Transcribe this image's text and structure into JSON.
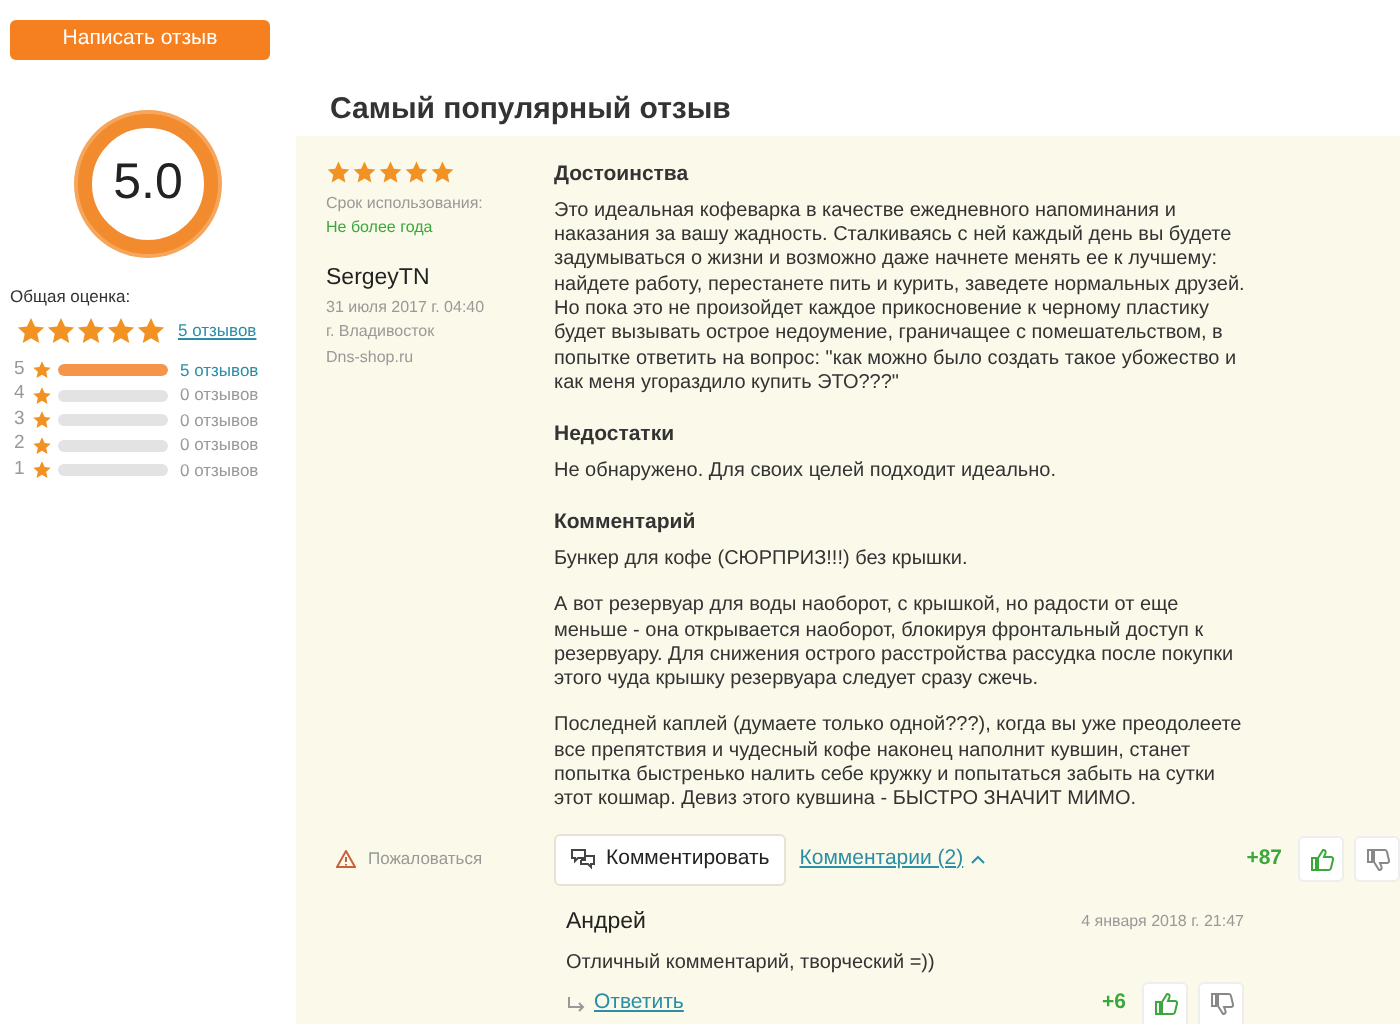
{
  "write_review_button": "Написать отзыв",
  "rating": {
    "score": "5.0",
    "overall_label": "Общая оценка:",
    "stars": 5,
    "count_link": "5 отзывов",
    "distribution": [
      {
        "grade": "5",
        "level": 1,
        "count": "5 отзывов",
        "link": true
      },
      {
        "grade": "4",
        "level": 0,
        "count": "0 отзывов",
        "link": false
      },
      {
        "grade": "3",
        "level": 0,
        "count": "0 отзывов",
        "link": false
      },
      {
        "grade": "2",
        "level": 0,
        "count": "0 отзывов",
        "link": false
      },
      {
        "grade": "1",
        "level": 0,
        "count": "0 отзывов",
        "link": false
      }
    ]
  },
  "section_title": "Самый популярный отзыв",
  "review": {
    "stars": 5,
    "usage_label": "Срок использования:",
    "usage_value": "Не более года",
    "author": "SergeyTN",
    "date": "31 июля 2017 г. 04:40",
    "city": "г. Владивосток",
    "source": "Dns-shop.ru",
    "sections": [
      {
        "heading": "Достоинства",
        "paragraphs": [
          "Это идеальная кофеварка в качестве ежедневного напоминания и\nнаказания за вашу жадность. Сталкиваясь с ней каждый день вы будете\nзадумываться о жизни и возможно даже начнете менять ее к лучшему:\nнайдете работу, перестанете пить и курить, заведете нормальных друзей.\nНо пока это не произойдет каждое прикосновение к черному пластику\nбудет вызывать острое недоумение, граничащее с помешательством, в\nпопытке ответить на вопрос: \"как можно было создать такое убожество и\nкак меня угораздило купить ЭТО???\""
        ]
      },
      {
        "heading": "Недостатки",
        "paragraphs": [
          "Не обнаружено. Для своих целей подходит идеально."
        ]
      },
      {
        "heading": "Комментарий",
        "paragraphs": [
          "Бункер для кофе (СЮРПРИЗ!!!) без крышки.",
          "А вот резервуар для воды наоборот, с крышкой, но радости от еще\nменьше - она открывается наоборот, блокируя фронтальный доступ к\nрезервуару. Для снижения острого расстройства рассудка после покупки\nэтого чуда крышку резервуара следует сразу сжечь.",
          "Последней каплей (думаете только одной???), когда вы уже преодолеете\nвсе препятствия и чудесный кофе наконец наполнит кувшин, станет\nпопытка быстренько налить себе кружку и попытаться забыть на сутки\nэтот кошмар. Девиз этого кувшина - БЫСТРО ЗНАЧИТ МИМО."
        ]
      }
    ],
    "report": "Пожаловаться",
    "comment_button": "Комментировать",
    "comments_toggle": "Комментарии (2)",
    "expanded": true,
    "votes": "+87"
  },
  "comments": [
    {
      "author": "Андрей",
      "date": "4 января 2018 г. 21:47",
      "text": "Отличный комментарий, творческий =))",
      "reply": "Ответить",
      "votes": "+6"
    }
  ]
}
